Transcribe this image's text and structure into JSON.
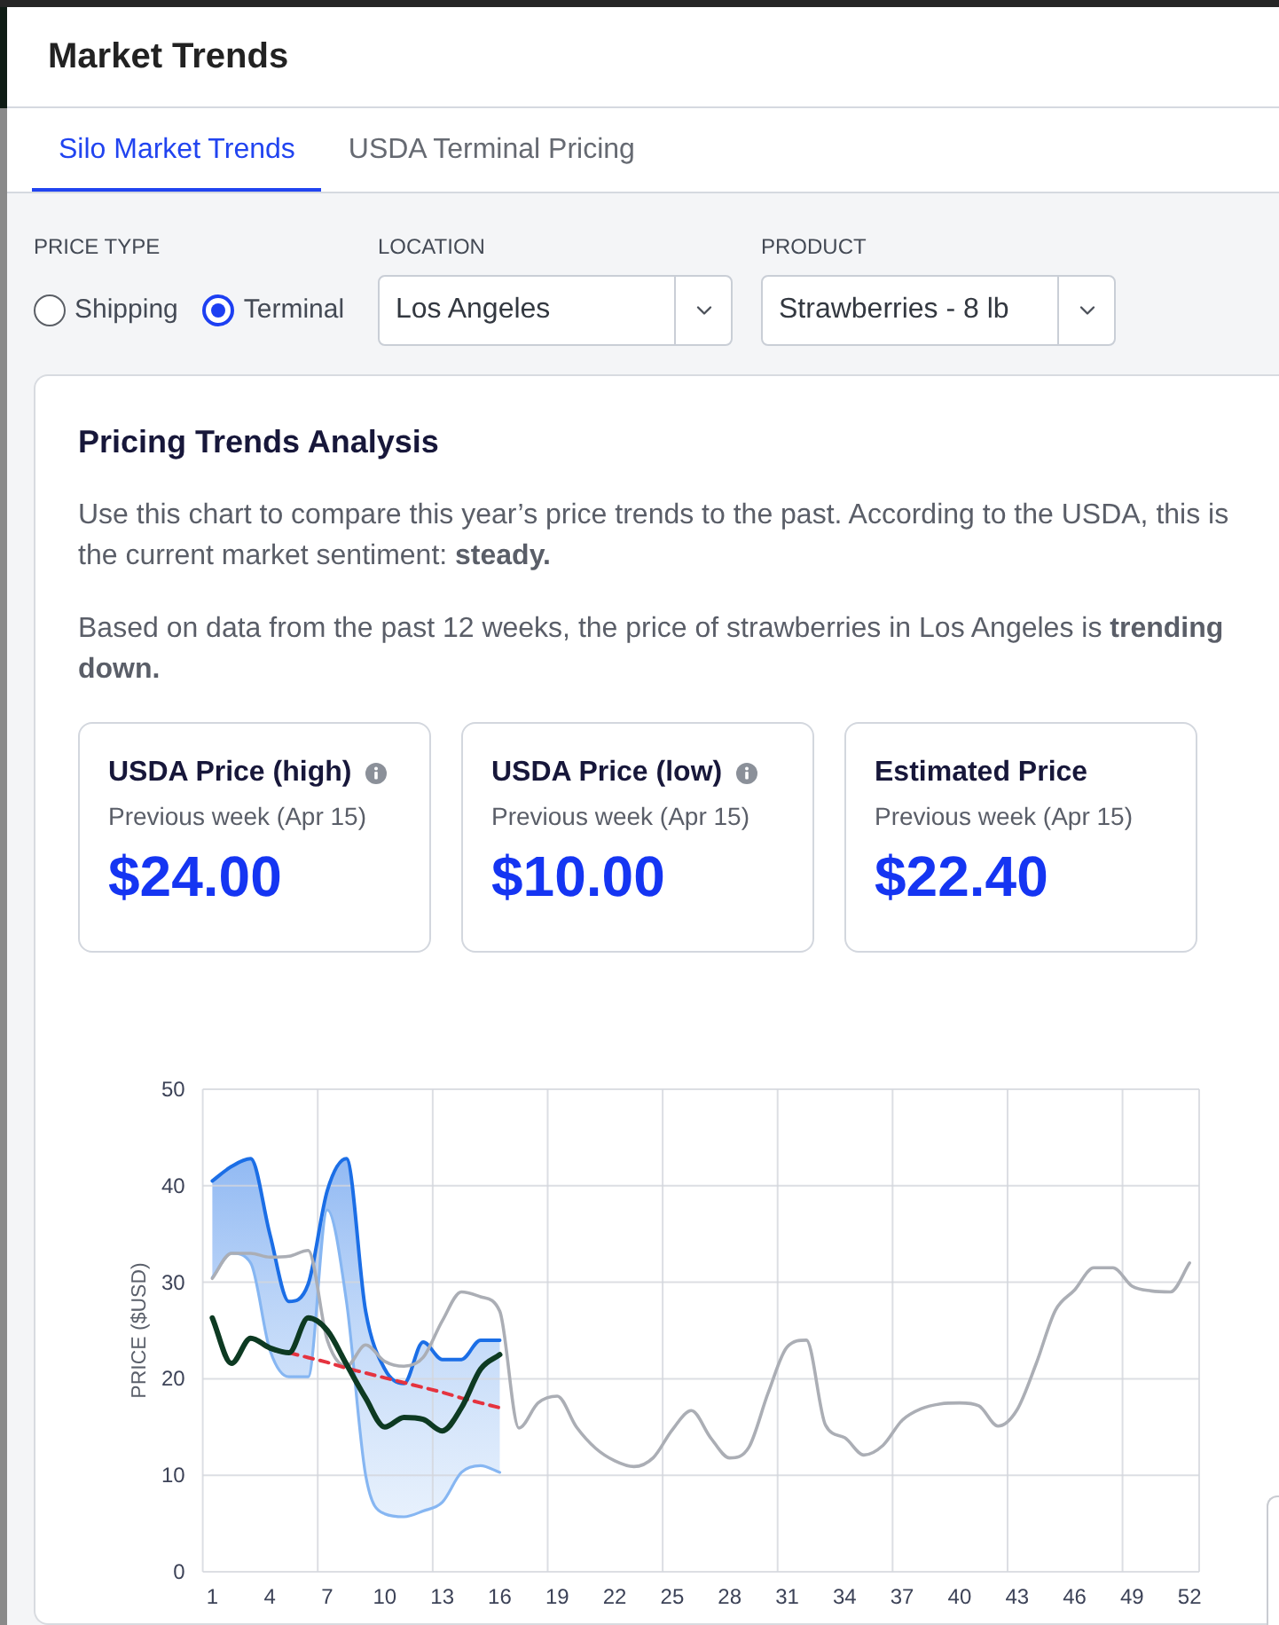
{
  "window": {
    "title": "Market Trends"
  },
  "tabs": [
    {
      "label": "Silo Market Trends",
      "selected": true
    },
    {
      "label": "USDA Terminal Pricing",
      "selected": false
    }
  ],
  "filters": [
    {
      "kind": "radio",
      "label": "PRICE TYPE",
      "options": [
        {
          "label": "Shipping",
          "selected": false
        },
        {
          "label": "Terminal",
          "selected": true
        }
      ]
    },
    {
      "kind": "select",
      "label": "LOCATION",
      "value": "Los Angeles"
    },
    {
      "kind": "select",
      "label": "PRODUCT",
      "value": "Strawberries - 8 lb"
    }
  ],
  "analysis": {
    "title": "Pricing Trends Analysis",
    "paragraphs": [
      "Use this chart to compare this year’s price trends to the past. According to the USDA, this is the current market sentiment: **steady.**",
      "Based on data from the past 12 weeks, the price of strawberries in Los Angeles is **trending down.**"
    ],
    "stats": [
      {
        "title": "USDA Price (high)",
        "info": true,
        "subtitle": "Previous week (Apr 15)",
        "value": "$24.00"
      },
      {
        "title": "USDA Price (low)",
        "info": true,
        "subtitle": "Previous week (Apr 15)",
        "value": "$10.00"
      },
      {
        "title": "Estimated Price",
        "info": false,
        "subtitle": "Previous week (Apr 15)",
        "value": "$22.40"
      }
    ],
    "chart_data": {
      "type": "line",
      "ylabel": "PRICE ($USD)",
      "grid": true,
      "x": [
        1,
        2,
        3,
        4,
        5,
        6,
        7,
        8,
        9,
        10,
        11,
        12,
        13,
        14,
        15,
        16,
        17,
        18,
        19,
        20,
        21,
        22,
        23,
        24,
        25,
        26,
        27,
        28,
        29,
        30,
        31,
        32,
        33,
        34,
        35,
        36,
        37,
        38,
        39,
        40,
        41,
        42,
        43,
        44,
        45,
        46,
        47,
        48,
        49,
        50,
        51,
        52
      ],
      "xlim": [
        0.5,
        52.5
      ],
      "ylim": [
        0,
        50
      ],
      "xticks": [
        1,
        4,
        7,
        10,
        13,
        16,
        19,
        22,
        25,
        28,
        31,
        34,
        37,
        40,
        43,
        46,
        49,
        52
      ],
      "yticks": [
        0,
        10,
        20,
        30,
        40,
        50
      ],
      "series": [
        {
          "color": "#1b6ee6",
          "values": [
            40.5,
            42,
            42.8,
            35,
            28,
            29.8,
            39.5,
            42.8,
            27,
            21,
            19.5,
            23.8,
            22,
            22,
            24,
            24,
            null,
            null,
            null,
            null,
            null,
            null,
            null,
            null,
            null,
            null,
            null,
            null,
            null,
            null,
            null,
            null,
            null,
            null,
            null,
            null,
            null,
            null,
            null,
            null,
            null,
            null,
            null,
            null,
            null,
            null,
            null,
            null,
            null,
            null,
            null,
            null
          ]
        },
        {
          "color": "#86b6f2",
          "values": [
            30.5,
            33,
            32,
            23,
            20.2,
            20.2,
            37.5,
            28,
            10,
            6,
            5.7,
            6.3,
            7.2,
            10.3,
            11,
            10.3,
            null,
            null,
            null,
            null,
            null,
            null,
            null,
            null,
            null,
            null,
            null,
            null,
            null,
            null,
            null,
            null,
            null,
            null,
            null,
            null,
            null,
            null,
            null,
            null,
            null,
            null,
            null,
            null,
            null,
            null,
            null,
            null,
            null,
            null,
            null,
            null
          ]
        },
        {
          "color": "#abaeb5",
          "values": [
            30.4,
            33,
            33,
            32.6,
            32.7,
            33.3,
            24,
            21.3,
            23.5,
            21.8,
            21.3,
            22.2,
            26,
            29,
            28.5,
            27,
            14.9,
            17.5,
            18.2,
            15,
            12.8,
            11.5,
            10.9,
            11.8,
            14.7,
            16.7,
            13.9,
            11.8,
            12.9,
            18.5,
            23.3,
            24,
            15.2,
            13.9,
            12.1,
            13.1,
            15.7,
            16.9,
            17.4,
            17.5,
            17.2,
            15.1,
            16.8,
            21.6,
            27.1,
            29.2,
            31.5,
            31.5,
            29.6,
            29.1,
            29,
            32
          ]
        },
        {
          "color": "#e5333f",
          "line_style": "dashed",
          "values": [
            null,
            null,
            null,
            null,
            22.7,
            22.2,
            21.7,
            21.1,
            20.6,
            20.1,
            19.6,
            19.1,
            18.6,
            18,
            17.5,
            17,
            null,
            null,
            null,
            null,
            null,
            null,
            null,
            null,
            null,
            null,
            null,
            null,
            null,
            null,
            null,
            null,
            null,
            null,
            null,
            null,
            null,
            null,
            null,
            null,
            null,
            null,
            null,
            null,
            null,
            null,
            null,
            null,
            null,
            null,
            null,
            null
          ]
        },
        {
          "color": "#0d3a22",
          "values": [
            26.3,
            21.6,
            24.2,
            23.2,
            22.7,
            26.3,
            25,
            21.5,
            18,
            15,
            16,
            15.8,
            14.6,
            17,
            21,
            22.5,
            null,
            null,
            null,
            null,
            null,
            null,
            null,
            null,
            null,
            null,
            null,
            null,
            null,
            null,
            null,
            null,
            null,
            null,
            null,
            null,
            null,
            null,
            null,
            null,
            null,
            null,
            null,
            null,
            null,
            null,
            null,
            null,
            null,
            null,
            null,
            null
          ]
        }
      ]
    }
  }
}
